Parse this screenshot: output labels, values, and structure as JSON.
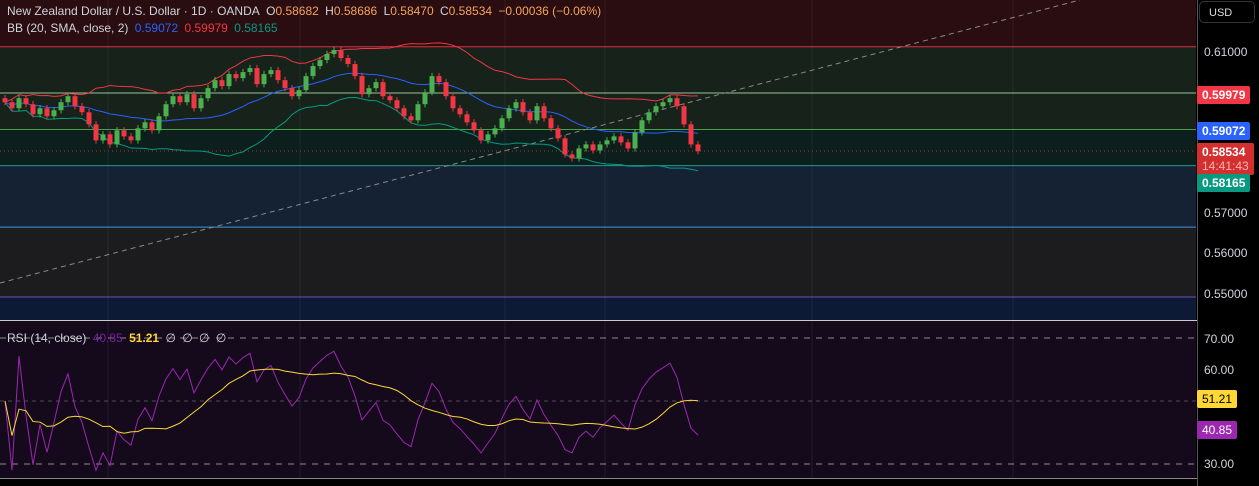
{
  "header": {
    "symbol": "New Zealand Dollar / U.S. Dollar · 1D · OANDA",
    "o_label": "O",
    "o": "0.58682",
    "h_label": "H",
    "h": "0.58686",
    "l_label": "L",
    "l": "0.58470",
    "c_label": "C",
    "c": "0.58534",
    "change": "−0.00036 (−0.06%)"
  },
  "bb": {
    "label": "BB (20, SMA, close, 2)",
    "basis": "0.59072",
    "upper": "0.59979",
    "lower": "0.58165"
  },
  "rsi": {
    "label": "RSI (14, close)",
    "value": "40.85",
    "ma": "51.21",
    "extras": [
      "∅",
      "∅",
      "∅",
      "∅"
    ]
  },
  "axis": {
    "currency": "USD",
    "price_ticks": [
      "0.61000",
      "0.57000",
      "0.56000",
      "0.55000"
    ],
    "rsi_ticks": [
      "70.00",
      "60.00",
      "30.00"
    ],
    "last_price": "0.58534",
    "countdown": "14:41:43"
  },
  "colors": {
    "up": "#4caf50",
    "down": "#f23645",
    "basis": "#2962ff",
    "upper": "#f23645",
    "lower": "#089981",
    "rsi": "#9c27b0",
    "rsi_ma": "#fdd835"
  },
  "chart_data": {
    "type": "candlestick",
    "ylim": [
      0.545,
      0.623
    ],
    "rsi_ylim": [
      25,
      75
    ],
    "closes": [
      0.5975,
      0.596,
      0.5985,
      0.597,
      0.5945,
      0.596,
      0.594,
      0.5955,
      0.5975,
      0.599,
      0.5965,
      0.595,
      0.592,
      0.588,
      0.5895,
      0.587,
      0.5905,
      0.589,
      0.588,
      0.591,
      0.5925,
      0.5905,
      0.594,
      0.597,
      0.599,
      0.5975,
      0.5995,
      0.596,
      0.5985,
      0.601,
      0.603,
      0.6015,
      0.6045,
      0.6035,
      0.605,
      0.606,
      0.602,
      0.6045,
      0.6055,
      0.603,
      0.601,
      0.599,
      0.6005,
      0.604,
      0.6065,
      0.608,
      0.6095,
      0.6105,
      0.6085,
      0.607,
      0.604,
      0.5995,
      0.601,
      0.6025,
      0.599,
      0.598,
      0.596,
      0.594,
      0.593,
      0.597,
      0.6,
      0.604,
      0.6025,
      0.599,
      0.596,
      0.5945,
      0.5925,
      0.5905,
      0.588,
      0.5895,
      0.591,
      0.5935,
      0.596,
      0.5975,
      0.595,
      0.593,
      0.5965,
      0.5935,
      0.591,
      0.5885,
      0.5845,
      0.5835,
      0.586,
      0.587,
      0.5855,
      0.587,
      0.588,
      0.589,
      0.5875,
      0.586,
      0.59,
      0.593,
      0.595,
      0.5965,
      0.5975,
      0.5985,
      0.5965,
      0.592,
      0.587,
      0.5853
    ],
    "zones": [
      0.6113,
      0.5998,
      0.5907,
      0.5817,
      0.5664,
      0.549
    ]
  }
}
